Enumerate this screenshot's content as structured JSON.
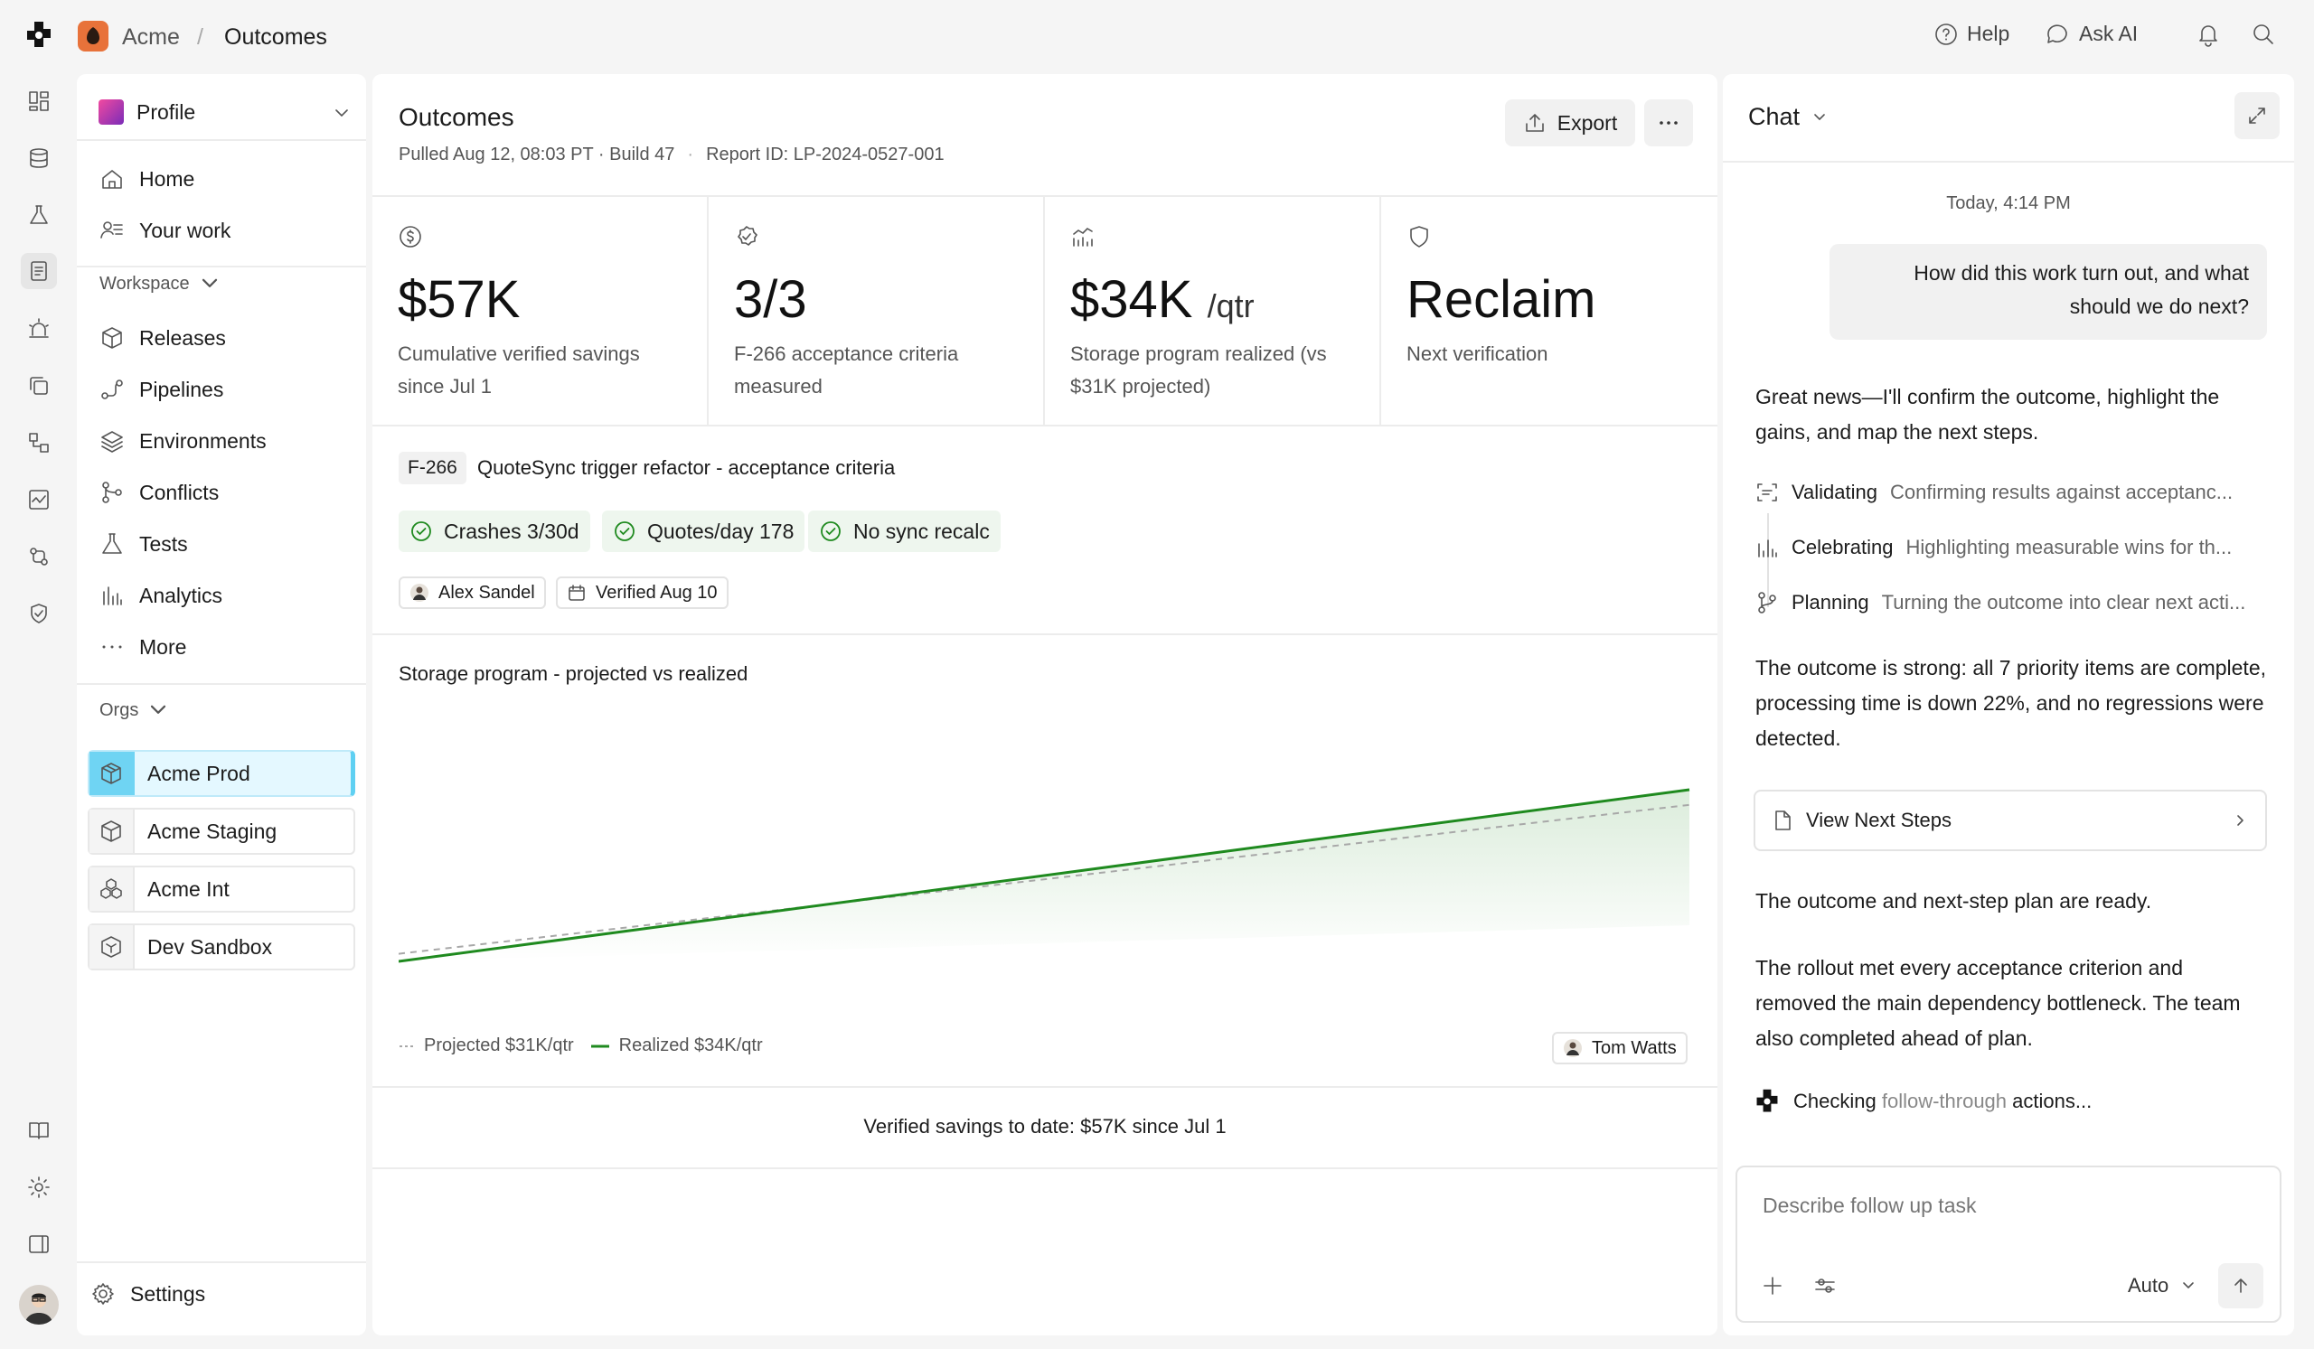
{
  "topbar": {
    "org": "Acme",
    "separator": "/",
    "page": "Outcomes",
    "help": "Help",
    "ask_ai": "Ask AI"
  },
  "sidebar": {
    "profile": "Profile",
    "primary": [
      {
        "label": "Home",
        "icon": "home-icon"
      },
      {
        "label": "Your work",
        "icon": "your-work-icon"
      }
    ],
    "workspace_label": "Workspace",
    "workspace_items": [
      {
        "label": "Releases",
        "icon": "package-icon"
      },
      {
        "label": "Pipelines",
        "icon": "pipeline-icon"
      },
      {
        "label": "Environments",
        "icon": "layers-icon"
      },
      {
        "label": "Conflicts",
        "icon": "git-merge-icon"
      },
      {
        "label": "Tests",
        "icon": "flask-icon"
      },
      {
        "label": "Analytics",
        "icon": "bar-chart-icon"
      },
      {
        "label": "More",
        "icon": "more-icon"
      }
    ],
    "orgs_label": "Orgs",
    "orgs": [
      {
        "label": "Acme Prod",
        "active": true
      },
      {
        "label": "Acme Staging",
        "active": false
      },
      {
        "label": "Acme Int",
        "active": false
      },
      {
        "label": "Dev Sandbox",
        "active": false
      }
    ],
    "settings": "Settings"
  },
  "main": {
    "title": "Outcomes",
    "meta_pulled": "Pulled Aug 12, 08:03 PT · Build 47",
    "meta_dot": "·",
    "meta_report": "Report ID: LP-2024-0527-001",
    "export": "Export",
    "kpis": [
      {
        "value": "$57K",
        "unit": "",
        "caption": "Cumulative verified savings since Jul 1",
        "icon": "dollar-icon"
      },
      {
        "value": "3/3",
        "unit": "",
        "caption": "F-266 acceptance criteria measured",
        "icon": "badge-check-icon"
      },
      {
        "value": "$34K",
        "unit": "/qtr",
        "caption": "Storage program realized (vs $31K projected)",
        "icon": "chart-line-icon"
      },
      {
        "value": "Reclaim",
        "unit": "",
        "caption": "Next verification",
        "icon": "shield-icon"
      }
    ],
    "ticket_id": "F-266",
    "ticket_title": "QuoteSync trigger refactor - acceptance criteria",
    "criteria": [
      "Crashes 3/30d",
      "Quotes/day 178",
      "No sync recalc"
    ],
    "owner": "Alex Sandel",
    "verified": "Verified Aug 10",
    "chart_title": "Storage program - projected vs realized",
    "legend_projected": "Projected $31K/qtr",
    "legend_realized": "Realized $34K/qtr",
    "chart_owner": "Tom Watts",
    "footer": "Verified savings to date: $57K since Jul 1"
  },
  "chart_data": {
    "type": "line",
    "title": "Storage program - projected vs realized",
    "x": [
      0,
      1
    ],
    "series": [
      {
        "name": "Projected $31K/qtr",
        "values": [
          0,
          31
        ],
        "style": "dashed",
        "color": "#a8a8a8"
      },
      {
        "name": "Realized $34K/qtr",
        "values": [
          0,
          34
        ],
        "style": "solid",
        "color": "#1f8a1f"
      }
    ],
    "ylim": [
      0,
      34
    ],
    "grid": false,
    "legend": "bottom-left"
  },
  "chat": {
    "title": "Chat",
    "timestamp": "Today, 4:14 PM",
    "user_message": "How did this work turn out, and what should we do next?",
    "reply_intro": "Great news—I'll confirm the outcome, highlight the gains, and map the next steps.",
    "steps": [
      {
        "name": "Validating",
        "desc": "Confirming results against acceptanc...",
        "icon": "scan-icon"
      },
      {
        "name": "Celebrating",
        "desc": "Highlighting measurable wins for th...",
        "icon": "bar-chart-icon"
      },
      {
        "name": "Planning",
        "desc": "Turning the outcome into clear next acti...",
        "icon": "git-branch-icon"
      }
    ],
    "summary": "The outcome is strong: all 7 priority items are complete, processing time is down 22%, and no regressions were detected.",
    "next_steps_button": "View Next Steps",
    "ready": "The outcome and next-step plan are ready.",
    "detail": "The rollout met every acceptance criterion and removed the main dependency bottleneck. The team also completed ahead of plan.",
    "status_a": "Checking ",
    "status_b": "follow-through",
    "status_c": " actions...",
    "input_placeholder": "Describe follow up task",
    "mode": "Auto"
  },
  "colors": {
    "accent_green": "#1f8a1f",
    "active_org": "#6fd4f3",
    "chip_bg": "#eef6ee"
  }
}
